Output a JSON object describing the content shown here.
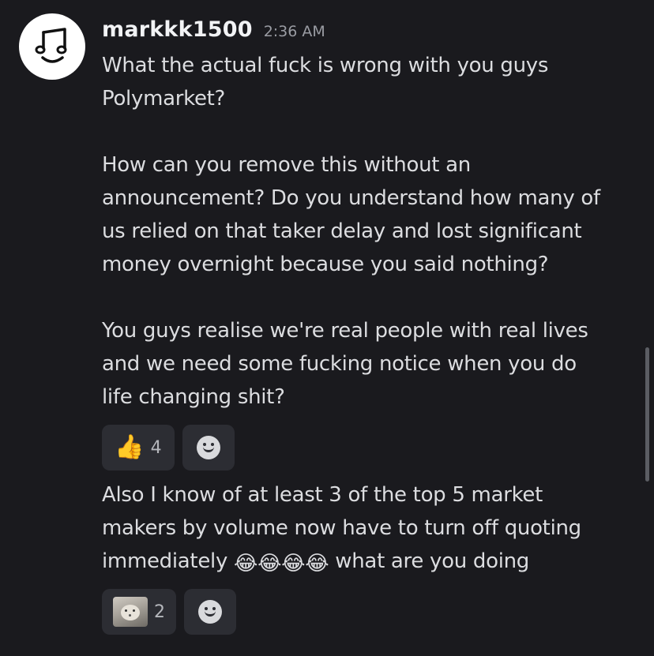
{
  "message": {
    "author": "markkk1500",
    "timestamp": "2:36 AM",
    "avatar_icon": "music-note-face-icon",
    "text_1": "What the actual fuck is wrong with you guys\nPolymarket?\n\nHow can you remove this without an\nannouncement? Do you understand how many of\nus relied on that taker delay and lost significant\nmoney overnight because you said nothing?\n\nYou guys realise we're real people with real lives\nand we need some fucking notice when you do\nlife changing shit?",
    "reactions_1": [
      {
        "emoji": "👍",
        "emoji_name": "thumbs-up-icon",
        "count": "4"
      }
    ],
    "text_2_part_1": "Also I know of at least 3 of the top 5 market\nmakers by volume now have to turn off quoting\nimmediately ",
    "text_2_emojis": "😂😂😂😂",
    "text_2_part_2": " what are you doing",
    "reactions_2": [
      {
        "emoji_name": "cat-face-icon",
        "count": "2"
      }
    ]
  },
  "add_reaction_icon": "add-reaction-icon",
  "colors": {
    "background": "#1a1a1e",
    "text": "#dcdde0",
    "username": "#f2f3f5",
    "timestamp": "#9a9ca3",
    "reaction_bg": "#2c2d33"
  }
}
